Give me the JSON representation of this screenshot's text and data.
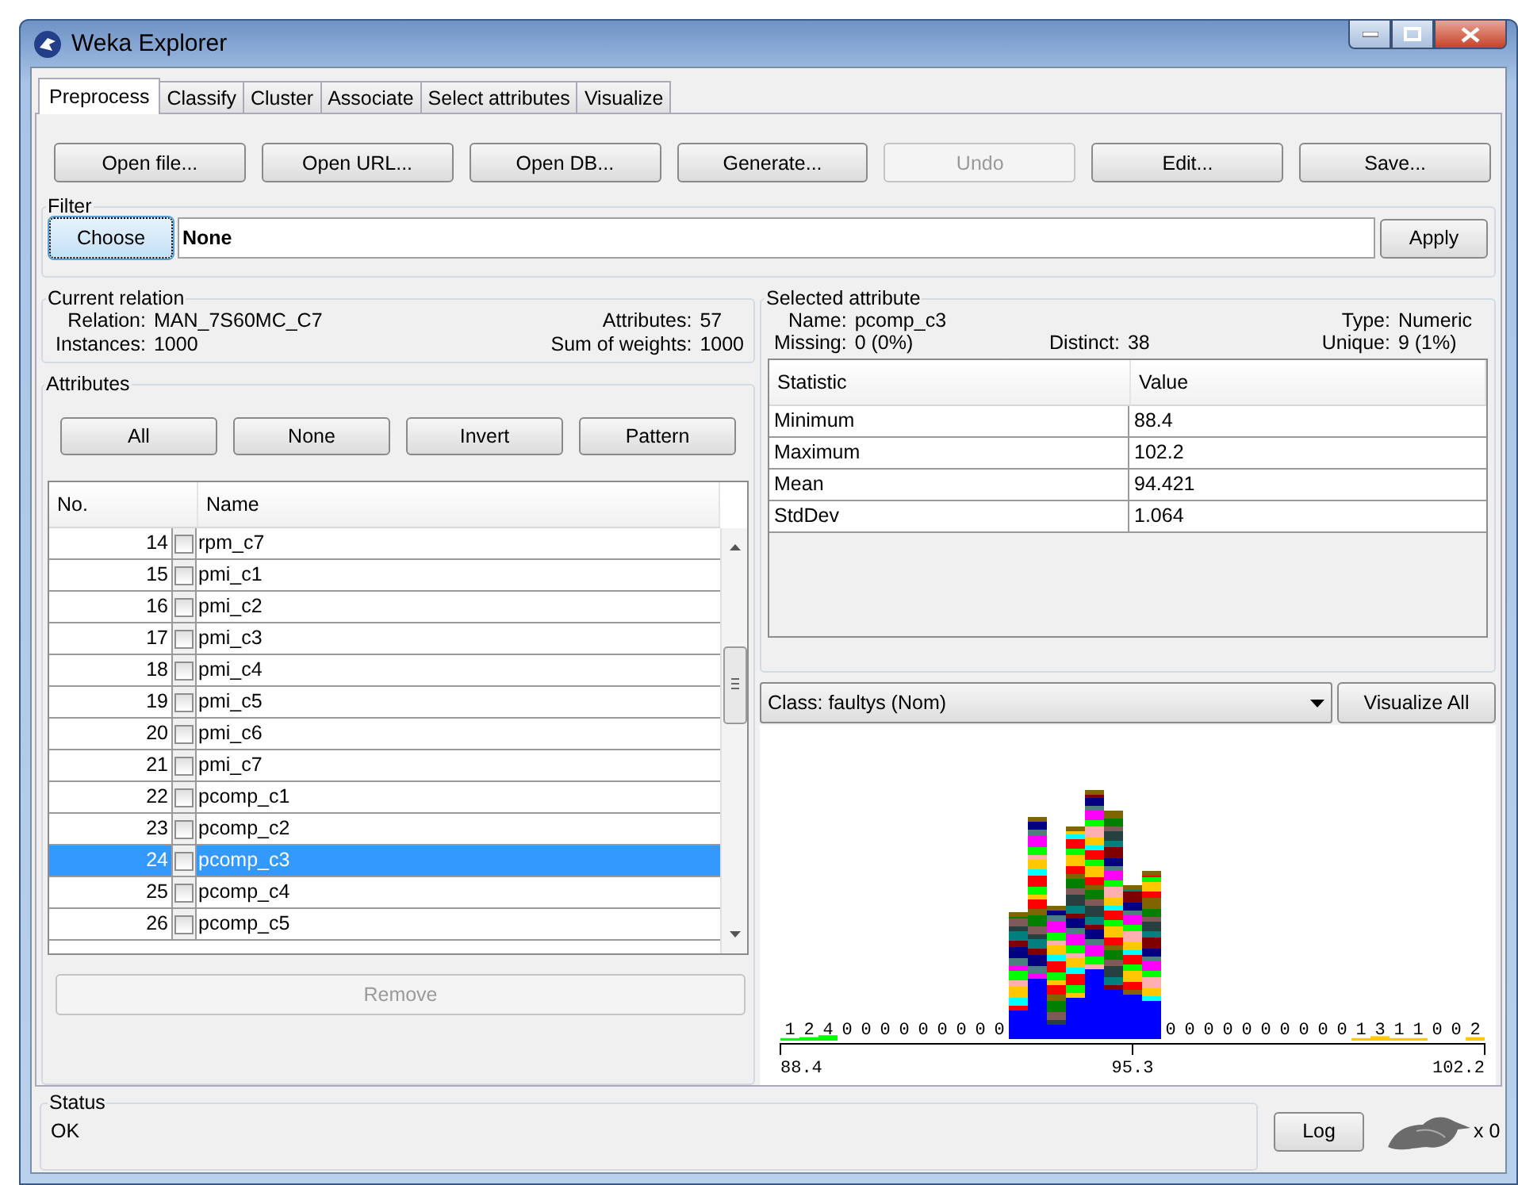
{
  "window": {
    "title": "Weka Explorer"
  },
  "tabs": [
    {
      "label": "Preprocess",
      "selected": true
    },
    {
      "label": "Classify",
      "selected": false
    },
    {
      "label": "Cluster",
      "selected": false
    },
    {
      "label": "Associate",
      "selected": false
    },
    {
      "label": "Select attributes",
      "selected": false
    },
    {
      "label": "Visualize",
      "selected": false
    }
  ],
  "toolbar_buttons": [
    {
      "label": "Open file...",
      "disabled": false
    },
    {
      "label": "Open URL...",
      "disabled": false
    },
    {
      "label": "Open DB...",
      "disabled": false
    },
    {
      "label": "Generate...",
      "disabled": false
    },
    {
      "label": "Undo",
      "disabled": true
    },
    {
      "label": "Edit...",
      "disabled": false
    },
    {
      "label": "Save...",
      "disabled": false
    }
  ],
  "filter": {
    "title": "Filter",
    "choose_button": "Choose",
    "value": "None",
    "apply_button": "Apply"
  },
  "current_relation": {
    "title": "Current relation",
    "fields": [
      {
        "label": "Relation:",
        "value": "MAN_7S60MC_C7"
      },
      {
        "label": "Attributes:",
        "value": "57"
      },
      {
        "label": "Instances:",
        "value": "1000"
      },
      {
        "label": "Sum of weights:",
        "value": "1000"
      }
    ]
  },
  "attributes": {
    "title": "Attributes",
    "buttons": [
      "All",
      "None",
      "Invert",
      "Pattern"
    ],
    "columns": [
      "No.",
      "Name"
    ],
    "rows": [
      {
        "no": "14",
        "name": "rpm_c7",
        "checked": false,
        "selected": false
      },
      {
        "no": "15",
        "name": "pmi_c1",
        "checked": false,
        "selected": false
      },
      {
        "no": "16",
        "name": "pmi_c2",
        "checked": false,
        "selected": false
      },
      {
        "no": "17",
        "name": "pmi_c3",
        "checked": false,
        "selected": false
      },
      {
        "no": "18",
        "name": "pmi_c4",
        "checked": false,
        "selected": false
      },
      {
        "no": "19",
        "name": "pmi_c5",
        "checked": false,
        "selected": false
      },
      {
        "no": "20",
        "name": "pmi_c6",
        "checked": false,
        "selected": false
      },
      {
        "no": "21",
        "name": "pmi_c7",
        "checked": false,
        "selected": false
      },
      {
        "no": "22",
        "name": "pcomp_c1",
        "checked": false,
        "selected": false
      },
      {
        "no": "23",
        "name": "pcomp_c2",
        "checked": false,
        "selected": false
      },
      {
        "no": "24",
        "name": "pcomp_c3",
        "checked": false,
        "selected": true
      },
      {
        "no": "25",
        "name": "pcomp_c4",
        "checked": false,
        "selected": false
      },
      {
        "no": "26",
        "name": "pcomp_c5",
        "checked": false,
        "selected": false
      }
    ],
    "remove_button": {
      "label": "Remove",
      "disabled": true
    }
  },
  "selected_attribute": {
    "title": "Selected attribute",
    "fields": [
      {
        "label": "Name:",
        "value": "pcomp_c3"
      },
      {
        "label": "Type:",
        "value": "Numeric"
      },
      {
        "label": "Missing:",
        "value": "0 (0%)"
      },
      {
        "label": "Distinct:",
        "value": "38"
      },
      {
        "label": "Unique:",
        "value": "9 (1%)"
      }
    ],
    "columns": [
      "Statistic",
      "Value"
    ],
    "rows": [
      {
        "statistic": "Minimum",
        "value": "88.4"
      },
      {
        "statistic": "Maximum",
        "value": "102.2"
      },
      {
        "statistic": "Mean",
        "value": "94.421"
      },
      {
        "statistic": "StdDev",
        "value": "1.064"
      }
    ]
  },
  "class_select": {
    "value": "Class: faultys (Nom)"
  },
  "visualize_all_button": "Visualize All",
  "histogram": {
    "bins": [
      {
        "kind": "count",
        "count": "1",
        "color": "#00ff00"
      },
      {
        "kind": "count",
        "count": "2",
        "color": "#00ff00"
      },
      {
        "kind": "count",
        "count": "4",
        "color": "#00ff00"
      },
      {
        "kind": "count",
        "count": "0"
      },
      {
        "kind": "count",
        "count": "0"
      },
      {
        "kind": "count",
        "count": "0"
      },
      {
        "kind": "count",
        "count": "0"
      },
      {
        "kind": "count",
        "count": "0"
      },
      {
        "kind": "count",
        "count": "0"
      },
      {
        "kind": "count",
        "count": "0"
      },
      {
        "kind": "count",
        "count": "0"
      },
      {
        "kind": "count",
        "count": "0"
      },
      {
        "kind": "bar"
      },
      {
        "kind": "bar"
      },
      {
        "kind": "bar"
      },
      {
        "kind": "bar"
      },
      {
        "kind": "bar"
      },
      {
        "kind": "bar"
      },
      {
        "kind": "bar"
      },
      {
        "kind": "bar"
      },
      {
        "kind": "count",
        "count": "0"
      },
      {
        "kind": "count",
        "count": "0"
      },
      {
        "kind": "count",
        "count": "0"
      },
      {
        "kind": "count",
        "count": "0"
      },
      {
        "kind": "count",
        "count": "0"
      },
      {
        "kind": "count",
        "count": "0"
      },
      {
        "kind": "count",
        "count": "0"
      },
      {
        "kind": "count",
        "count": "0"
      },
      {
        "kind": "count",
        "count": "0"
      },
      {
        "kind": "count",
        "count": "0"
      },
      {
        "kind": "count",
        "count": "1",
        "color": "#ffc800"
      },
      {
        "kind": "count",
        "count": "3",
        "color": "#ffc800"
      },
      {
        "kind": "count",
        "count": "1",
        "color": "#ffc800"
      },
      {
        "kind": "count",
        "count": "1",
        "color": "#ffc800"
      },
      {
        "kind": "count",
        "count": "0"
      },
      {
        "kind": "count",
        "count": "0"
      },
      {
        "kind": "count",
        "count": "2",
        "color": "#ffc800"
      }
    ],
    "axis_labels": [
      "88.4",
      "95.3",
      "102.2"
    ]
  },
  "status": {
    "title": "Status",
    "message": "OK",
    "log_button": "Log",
    "count": "x 0"
  }
}
